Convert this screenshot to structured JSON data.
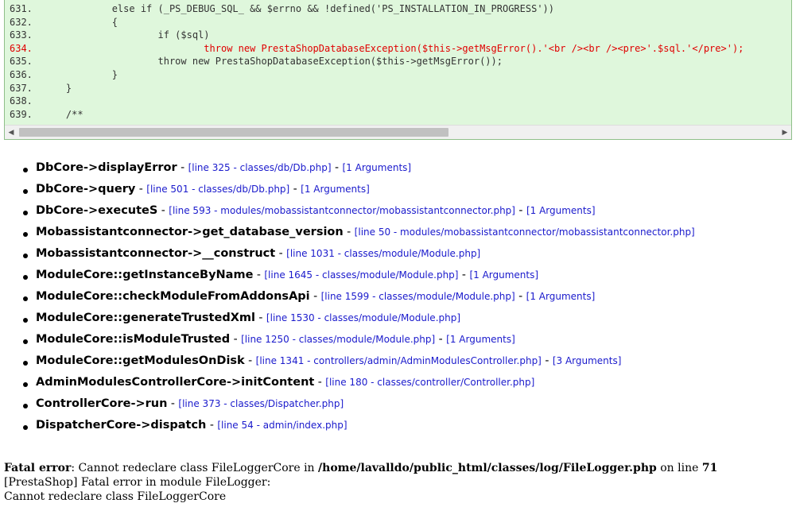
{
  "code": {
    "lines": [
      {
        "num": "631.",
        "text": "            else if (_PS_DEBUG_SQL_ && $errno && !defined('PS_INSTALLATION_IN_PROGRESS'))",
        "error": false
      },
      {
        "num": "632.",
        "text": "            {",
        "error": false
      },
      {
        "num": "633.",
        "text": "                    if ($sql)",
        "error": false
      },
      {
        "num": "634.",
        "text": "                            throw new PrestaShopDatabaseException($this->getMsgError().'<br /><br /><pre>'.$sql.'</pre>');",
        "error": true
      },
      {
        "num": "635.",
        "text": "                    throw new PrestaShopDatabaseException($this->getMsgError());",
        "error": false
      },
      {
        "num": "636.",
        "text": "            }",
        "error": false
      },
      {
        "num": "637.",
        "text": "    }",
        "error": false
      },
      {
        "num": "638.",
        "text": "",
        "error": false
      },
      {
        "num": "639.",
        "text": "    /**",
        "error": false
      }
    ],
    "scroll_left_icon": "triangle-left-icon",
    "scroll_right_icon": "triangle-right-icon"
  },
  "trace": [
    {
      "fn": "DbCore->displayError",
      "loc": "[line 325 - classes/db/Db.php]",
      "args": "[1 Arguments]"
    },
    {
      "fn": "DbCore->query",
      "loc": "[line 501 - classes/db/Db.php]",
      "args": "[1 Arguments]"
    },
    {
      "fn": "DbCore->executeS",
      "loc": "[line 593 - modules/mobassistantconnector/mobassistantconnector.php]",
      "args": "[1 Arguments]"
    },
    {
      "fn": "Mobassistantconnector->get_database_version",
      "loc": "[line 50 - modules/mobassistantconnector/mobassistantconnector.php]",
      "args": ""
    },
    {
      "fn": "Mobassistantconnector->__construct",
      "loc": "[line 1031 - classes/module/Module.php]",
      "args": ""
    },
    {
      "fn": "ModuleCore::getInstanceByName",
      "loc": "[line 1645 - classes/module/Module.php]",
      "args": "[1 Arguments]"
    },
    {
      "fn": "ModuleCore::checkModuleFromAddonsApi",
      "loc": "[line 1599 - classes/module/Module.php]",
      "args": "[1 Arguments]"
    },
    {
      "fn": "ModuleCore::generateTrustedXml",
      "loc": "[line 1530 - classes/module/Module.php]",
      "args": ""
    },
    {
      "fn": "ModuleCore::isModuleTrusted",
      "loc": "[line 1250 - classes/module/Module.php]",
      "args": "[1 Arguments]"
    },
    {
      "fn": "ModuleCore::getModulesOnDisk",
      "loc": "[line 1341 - controllers/admin/AdminModulesController.php]",
      "args": "[3 Arguments]"
    },
    {
      "fn": "AdminModulesControllerCore->initContent",
      "loc": "[line 180 - classes/controller/Controller.php]",
      "args": ""
    },
    {
      "fn": "ControllerCore->run",
      "loc": "[line 373 - classes/Dispatcher.php]",
      "args": ""
    },
    {
      "fn": "DispatcherCore->dispatch",
      "loc": "[line 54 - admin/index.php]",
      "args": ""
    }
  ],
  "fatal": {
    "label": "Fatal error",
    "message": ": Cannot redeclare class FileLoggerCore in ",
    "path": "/home/lavalldo/public_html/classes/log/FileLogger.php",
    "on_line": " on line ",
    "line_no": "71",
    "line2": "[PrestaShop] Fatal error in module FileLogger:",
    "line3": "Cannot redeclare class FileLoggerCore"
  }
}
